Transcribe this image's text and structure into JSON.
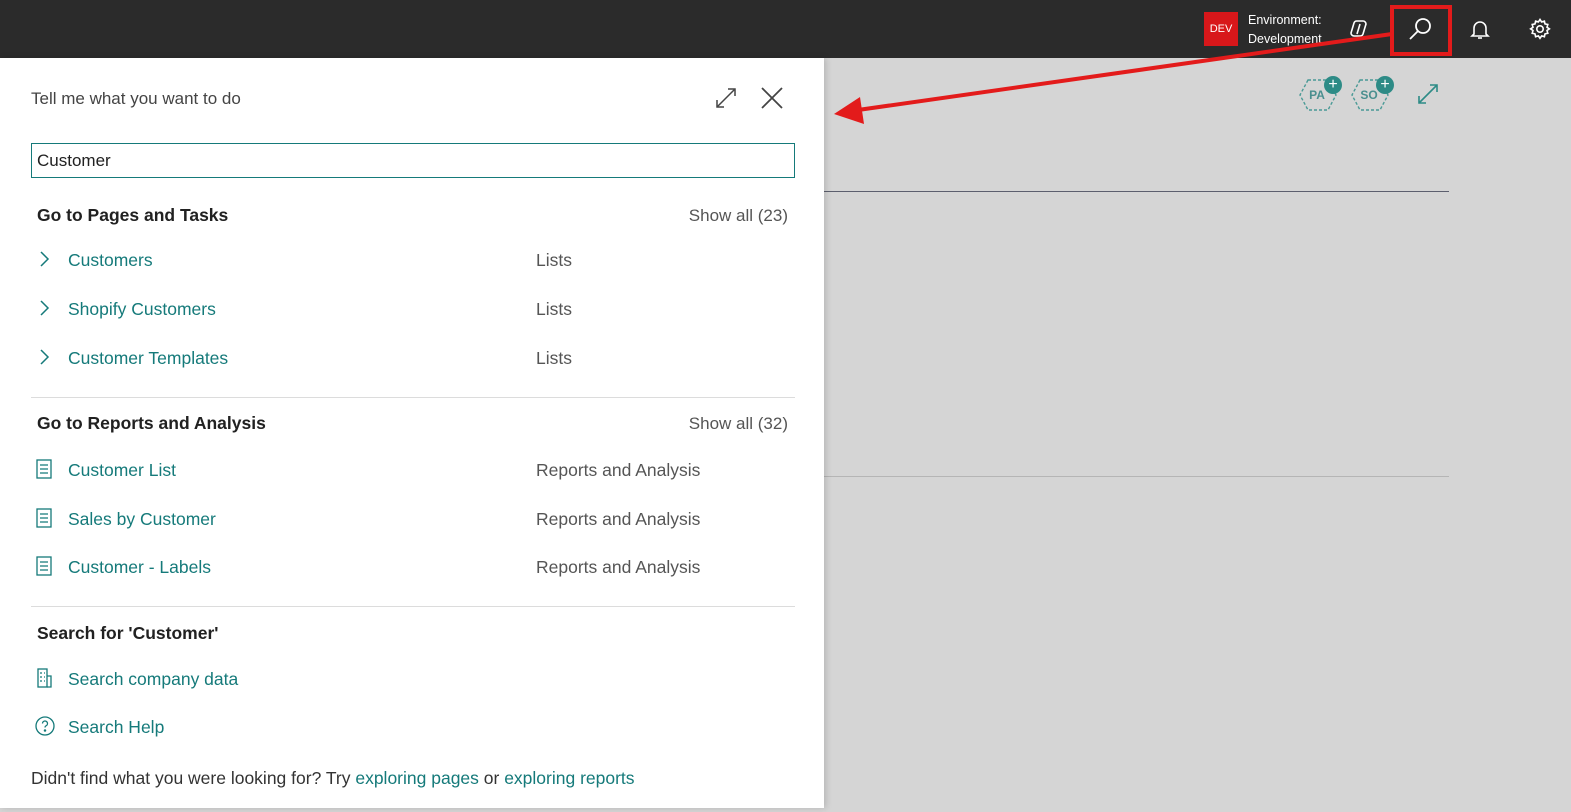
{
  "topbar": {
    "env_badge": "DEV",
    "env_line1": "Environment:",
    "env_line2": "Development",
    "icons": [
      "copilot-icon",
      "search-icon",
      "bell-icon",
      "gear-icon"
    ]
  },
  "background": {
    "avatars": [
      {
        "initials": "PA"
      },
      {
        "initials": "SO"
      }
    ]
  },
  "panel": {
    "title": "Tell me what you want to do",
    "search_value": "Customer",
    "pages_section": {
      "heading": "Go to Pages and Tasks",
      "show_all": "Show all (23)",
      "items": [
        {
          "name": "Customers",
          "category": "Lists"
        },
        {
          "name": "Shopify Customers",
          "category": "Lists"
        },
        {
          "name": "Customer Templates",
          "category": "Lists"
        }
      ]
    },
    "reports_section": {
      "heading": "Go to Reports and Analysis",
      "show_all": "Show all (32)",
      "items": [
        {
          "name": "Customer List",
          "category": "Reports and Analysis"
        },
        {
          "name": "Sales by Customer",
          "category": "Reports and Analysis"
        },
        {
          "name": "Customer - Labels",
          "category": "Reports and Analysis"
        }
      ]
    },
    "search_section": {
      "heading": "Search for 'Customer'",
      "items": [
        {
          "name": "Search company data",
          "icon": "building-icon"
        },
        {
          "name": "Search Help",
          "icon": "help-icon"
        }
      ]
    },
    "footer": {
      "prefix": "Didn't find what you were looking for? Try ",
      "link1": "exploring pages",
      "middle": " or ",
      "link2": "exploring reports"
    }
  },
  "colors": {
    "topbar_bg": "#2b2b2b",
    "accent": "#157a7a",
    "env_badge": "#d8171a",
    "annotation": "#e31b1b"
  }
}
